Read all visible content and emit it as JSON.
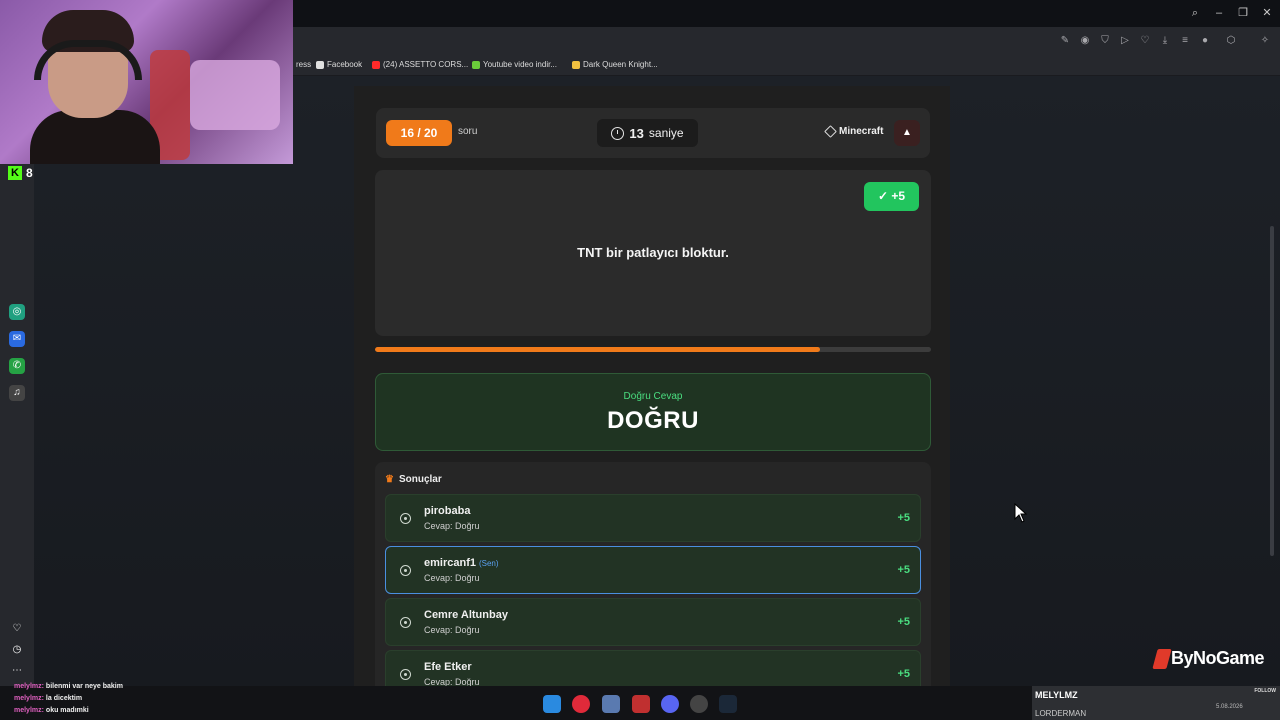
{
  "bookmarks": [
    {
      "label": "ress",
      "color": "#cccccc"
    },
    {
      "label": "Facebook",
      "color": "#e0e0e0"
    },
    {
      "label": "(24) ASSETTO CORS...",
      "color": "#ff2a2a"
    },
    {
      "label": "Youtube video indir...",
      "color": "#6acc3a"
    },
    {
      "label": "Dark Queen Knight...",
      "color": "#f0c040"
    }
  ],
  "quiz": {
    "progress_label": "16 / 20",
    "progress_unit": "soru",
    "progress_fraction": 0.8,
    "timer_value": "13",
    "timer_unit": "saniye",
    "category": "Minecraft",
    "points_badge": "✓  +5",
    "question": "TNT bir patlayıcı bloktur.",
    "correct_answer_label": "Doğru Cevap",
    "correct_answer": "DOĞRU",
    "results_title": "Sonuçlar",
    "results": [
      {
        "name": "pirobaba",
        "tag": "",
        "answer": "Cevap: Doğru",
        "points": "+5"
      },
      {
        "name": "emircanf1",
        "tag": "(Sen)",
        "answer": "Cevap: Doğru",
        "points": "+5"
      },
      {
        "name": "Cemre Altunbay",
        "tag": "",
        "answer": "Cevap: Doğru",
        "points": "+5"
      },
      {
        "name": "Efe Etker",
        "tag": "",
        "answer": "Cevap: Doğru",
        "points": "+5"
      }
    ]
  },
  "overlay": {
    "viewer_count": "8",
    "brand": "ByNoGame",
    "chat": [
      {
        "user": "melylmz:",
        "msg": "bilenmi var neye bakim"
      },
      {
        "user": "melylmz:",
        "msg": "la dicektim"
      },
      {
        "user": "melylmz:",
        "msg": "oku madımki"
      }
    ],
    "follow_name": "MELYLMZ",
    "follow_label": "FOLLOW",
    "follow_sub": "LORDERMAN",
    "date": "5.08.2026"
  },
  "colors": {
    "accent_orange": "#f07a1a",
    "success_green": "#22c55e",
    "self_border": "#4a8fe0"
  }
}
